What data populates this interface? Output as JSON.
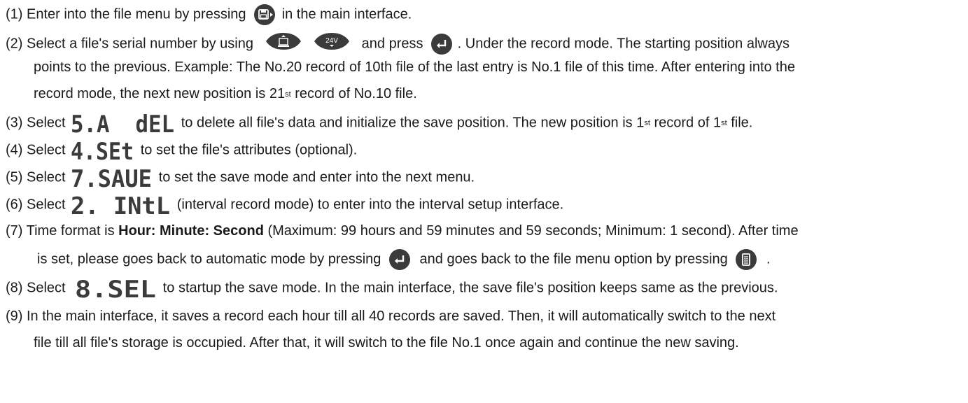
{
  "steps": [
    {
      "prefix": "(1) Enter into the file menu by pressing",
      "suffix": "in the main interface."
    },
    {
      "prefix": "(2) Select a file's serial number by using",
      "key_24v": "24V",
      "middle": "and press",
      "suffix": ". Under the record mode. The starting position always"
    },
    {
      "text": "points to the previous. Example: The No.20 record of 10th file of the last entry is No.1 file of this time. After entering into the"
    },
    {
      "prefix": "record mode, the next new position is 21",
      "sup": "st",
      "suffix": "record of No.10 file."
    },
    {
      "prefix": "(3) Select",
      "segment": "5.A _dEL",
      "mid": "to delete all file's data and initialize the save position. The new position is 1",
      "sup1": "st",
      "mid2": "record of 1",
      "sup2": "st",
      "suffix": "file."
    },
    {
      "prefix": "(4) Select",
      "segment": "4.SEt",
      "suffix": "to set the file's attributes (optional)."
    },
    {
      "prefix": "(5) Select",
      "segment": "7.SAUE",
      "suffix": "to set the save mode and enter into the next menu."
    },
    {
      "prefix": "(6) Select",
      "segment": "2. INtL",
      "suffix": "(interval record mode) to enter into the interval setup interface."
    },
    {
      "prefix": "(7) Time format is",
      "bold": "Hour: Minute: Second",
      "suffix": "(Maximum: 99 hours and 59 minutes and 59 seconds; Minimum: 1 second). After time"
    },
    {
      "prefix": "is set, please goes back to automatic mode by pressing",
      "middle": "and goes back to the file menu option by pressing",
      "suffix": "."
    },
    {
      "prefix": "(8) Select",
      "segment": "8.SEL",
      "suffix": "to startup the save mode. In the main interface, the save file's position keeps same as the previous."
    },
    {
      "text": "(9) In the main interface, it saves a record each hour till all 40 records are saved. Then, it will automatically switch to the next"
    },
    {
      "text": "file till all file's storage is occupied. After that, it will switch to the file No.1 once again and continue the new saving."
    }
  ]
}
